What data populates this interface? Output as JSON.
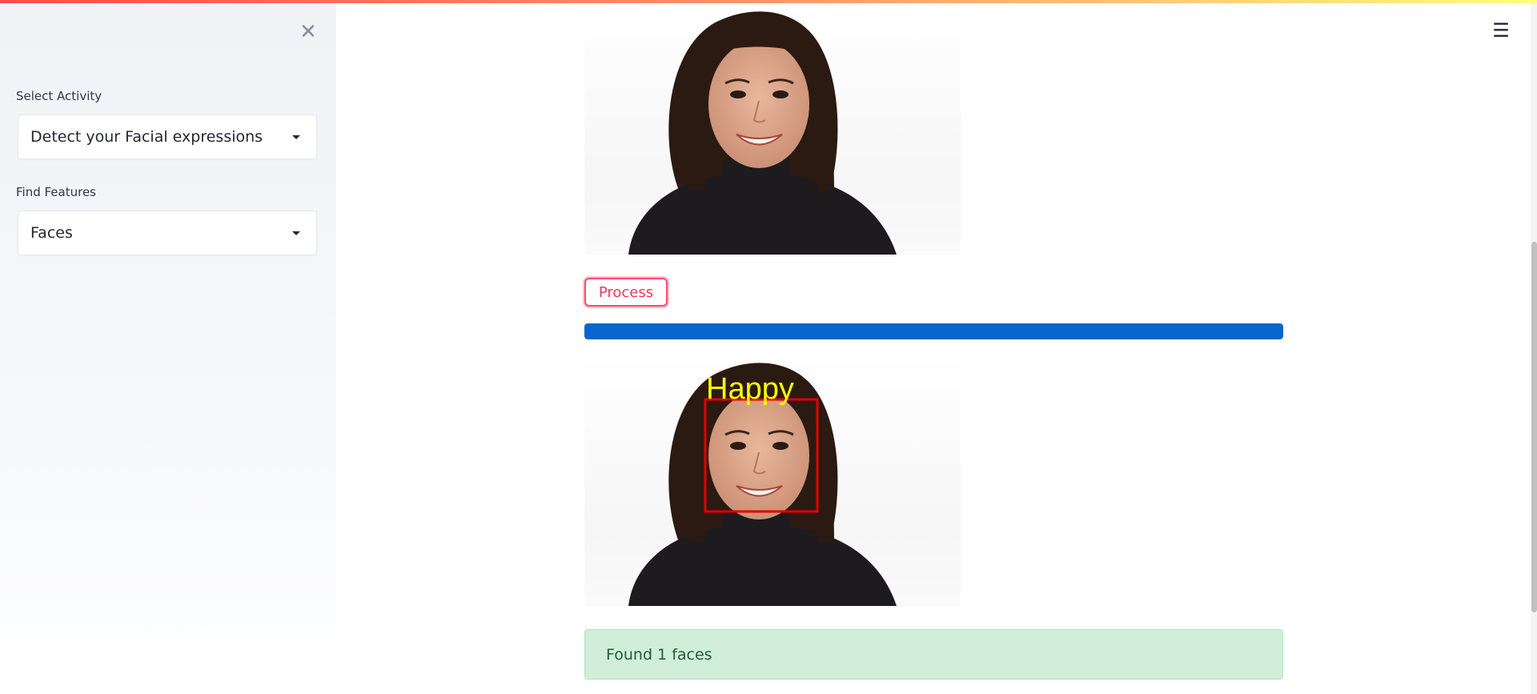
{
  "sidebar": {
    "close_icon": "close-icon",
    "activity_label": "Select Activity",
    "activity_value": "Detect your Facial expressions",
    "features_label": "Find Features",
    "features_value": "Faces"
  },
  "header": {
    "menu_icon": "hamburger-menu-icon"
  },
  "main": {
    "process_button": "Process",
    "progress": 1.0,
    "result_label": "Happy",
    "alert_text": "Found 1 faces"
  },
  "colors": {
    "accent": "#ff4b6e",
    "progress": "#0866cc",
    "success_bg": "#d0eed8",
    "box": "#e00000",
    "label": "#ffff00"
  }
}
